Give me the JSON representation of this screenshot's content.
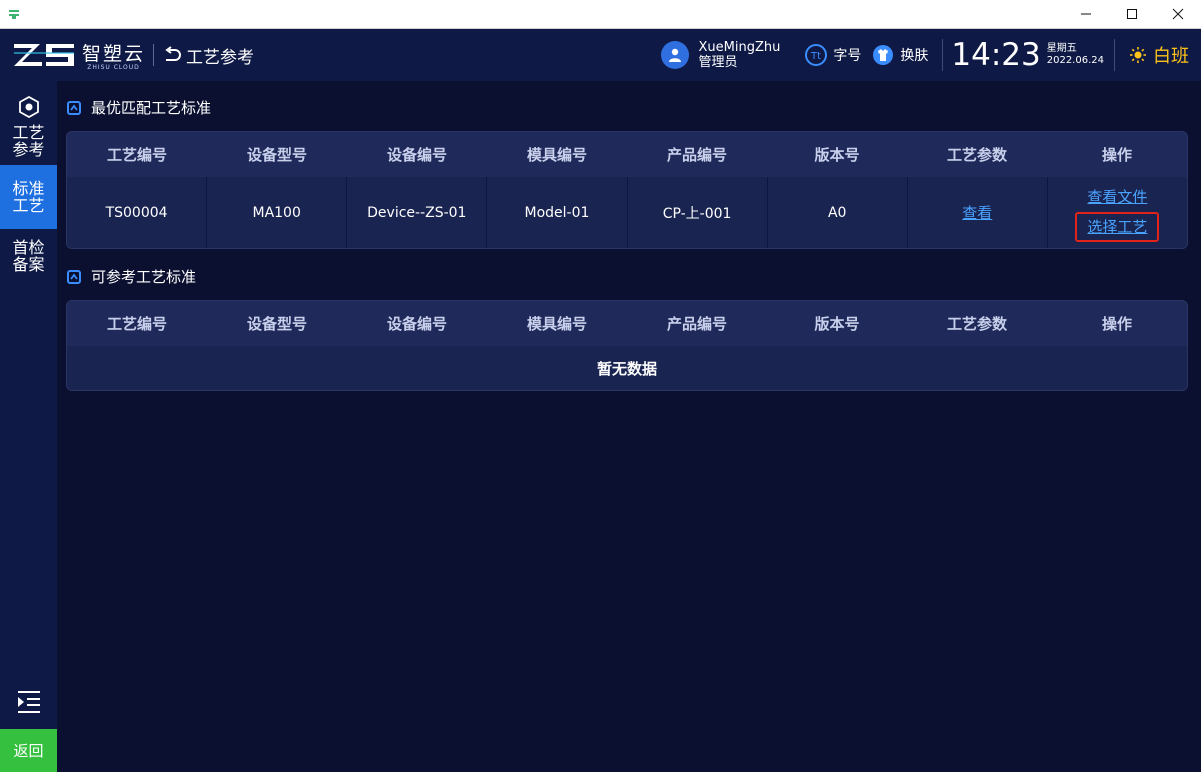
{
  "header": {
    "brand_name": "智塑云",
    "brand_sub": "ZHISU CLOUD",
    "page_title": "工艺参考",
    "user_name": "XueMingZhu",
    "user_role": "管理员",
    "font_label": "字号",
    "skin_label": "换肤",
    "time": "14:23",
    "weekday": "星期五",
    "date": "2022.06.24",
    "shift": "白班"
  },
  "sidebar": {
    "items": [
      {
        "label": "工艺参考",
        "active": false
      },
      {
        "label": "标准工艺",
        "active": true
      },
      {
        "label": "首检备案",
        "active": false
      }
    ],
    "return_label": "返回"
  },
  "columns": [
    "工艺编号",
    "设备型号",
    "设备编号",
    "模具编号",
    "产品编号",
    "版本号",
    "工艺参数",
    "操作"
  ],
  "best_match": {
    "title": "最优匹配工艺标准",
    "rows": [
      {
        "process_no": "TS00004",
        "device_model": "MA100",
        "device_no": "Device--ZS-01",
        "mold_no": "Model-01",
        "product_no": "CP-上-001",
        "version": "A0",
        "params_link": "查看",
        "op_view_file": "查看文件",
        "op_select": "选择工艺"
      }
    ]
  },
  "reference": {
    "title": "可参考工艺标准",
    "empty_text": "暂无数据"
  },
  "colors": {
    "background": "#0b1030",
    "header": "#0e1a45",
    "accent": "#1e6fe0",
    "link": "#4aa3ff",
    "shift": "#ffc21a",
    "return": "#35c13f",
    "highlight": "#e2231a"
  }
}
